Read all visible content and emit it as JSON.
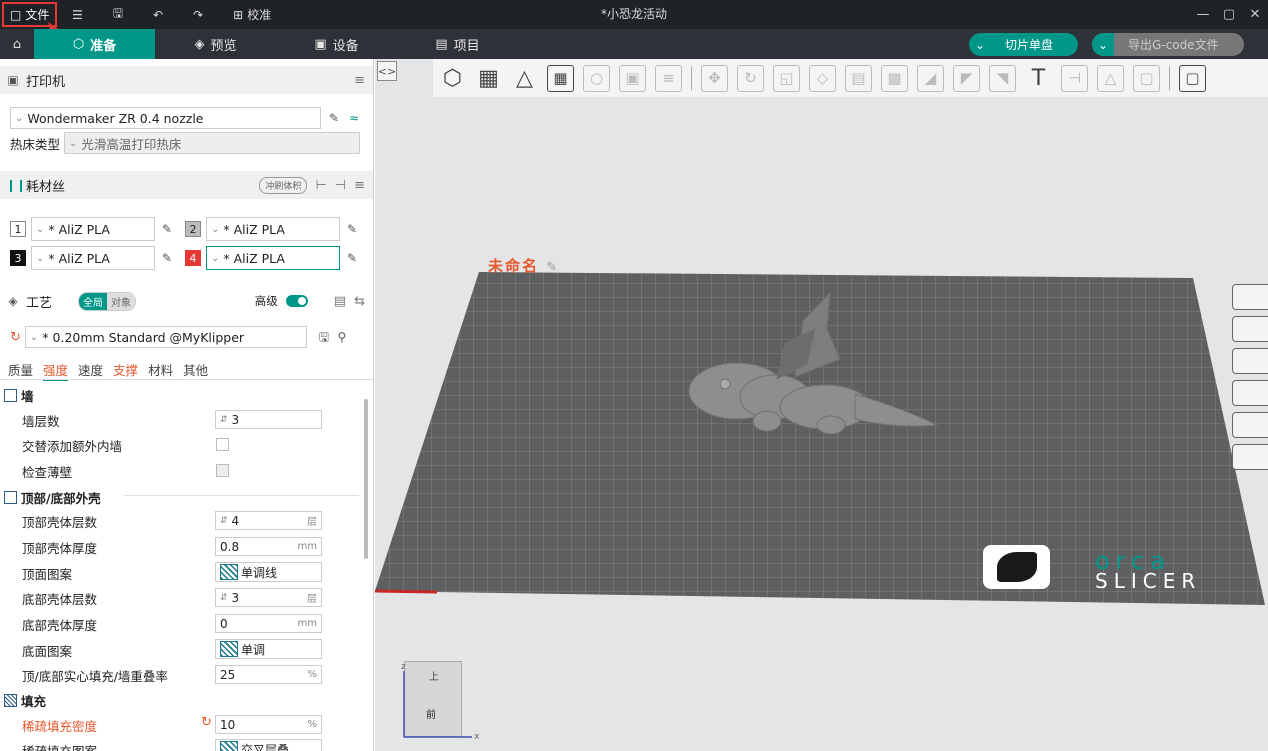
{
  "titlebar": {
    "file_label": "文件",
    "calibrate_label": "校准",
    "window_title": "*小恐龙活动",
    "minimize": "—",
    "restore": "▢",
    "close": "✕"
  },
  "nav": {
    "tabs": [
      {
        "label": "准备",
        "icon": "cube-icon",
        "active": true
      },
      {
        "label": "预览",
        "icon": "layers-icon"
      },
      {
        "label": "设备",
        "icon": "monitor-icon"
      },
      {
        "label": "项目",
        "icon": "list-icon"
      }
    ],
    "slice_label": "切片单盘",
    "export_label": "导出G-code文件",
    "accent": "#009688"
  },
  "printer": {
    "title": "打印机",
    "model": "Wondermaker ZR 0.4 nozzle",
    "bed_label": "热床类型",
    "bed_value": "光滑高温打印热床"
  },
  "filament": {
    "title": "耗材丝",
    "flush_label": "冲刷体积",
    "slots": [
      {
        "num": "1",
        "name": "* AliZ PLA",
        "color": "#ffffff",
        "text_color": "#222"
      },
      {
        "num": "2",
        "name": "* AliZ PLA",
        "color": "#bdbdbd",
        "text_color": "#222"
      },
      {
        "num": "3",
        "name": "* AliZ PLA",
        "color": "#111111",
        "text_color": "#fff"
      },
      {
        "num": "4",
        "name": "* AliZ PLA",
        "color": "#e53935",
        "text_color": "#fff"
      }
    ]
  },
  "process": {
    "title": "工艺",
    "global_label": "全局",
    "object_label": "对象",
    "advanced_label": "高级",
    "profile": "* 0.20mm Standard @MyKlipper",
    "tabs": [
      "质量",
      "强度",
      "速度",
      "支撑",
      "材料",
      "其他"
    ]
  },
  "params": {
    "wall_group": "墙",
    "wall_loops_label": "墙层数",
    "wall_loops": "3",
    "alt_wall_label": "交替添加额外内墙",
    "thin_wall_label": "检查薄壁",
    "shell_group": "顶部/底部外壳",
    "top_layers_label": "顶部壳体层数",
    "top_layers": "4",
    "layer_unit": "层",
    "top_thick_label": "顶部壳体厚度",
    "top_thick": "0.8",
    "mm_unit": "mm",
    "top_pattern_label": "顶面图案",
    "top_pattern": "单调线",
    "bottom_layers_label": "底部壳体层数",
    "bottom_layers": "3",
    "bottom_thick_label": "底部壳体厚度",
    "bottom_thick": "0",
    "bottom_pattern_label": "底面图案",
    "bottom_pattern": "单调",
    "overlap_label": "顶/底部实心填充/墙重叠率",
    "overlap": "25",
    "pct_unit": "%",
    "infill_group": "填充",
    "density_label": "稀疏填充密度",
    "density": "10",
    "infill_pattern_label": "稀疏填充图案",
    "infill_pattern": "交叉层叠"
  },
  "viewport": {
    "plate_name": "未命名",
    "logo_top": "orca",
    "logo_bottom": "SLICER",
    "cube_top": "上",
    "cube_front": "前",
    "axis_x": "x",
    "axis_z": "z"
  }
}
